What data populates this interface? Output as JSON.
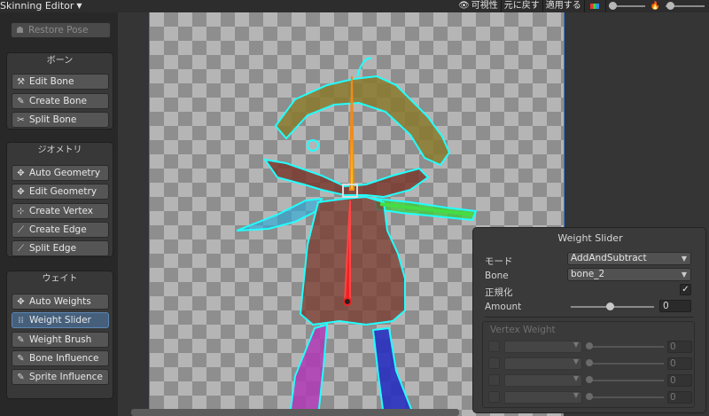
{
  "topbar": {
    "title": "Skinning Editor",
    "visibility_label": "可視性",
    "revert_label": "元に戻す",
    "apply_label": "適用する"
  },
  "restore_pose_label": "Restore Pose",
  "bone_group": {
    "title": "ボーン",
    "buttons": [
      "Edit Bone",
      "Create Bone",
      "Split Bone"
    ]
  },
  "geometry_group": {
    "title": "ジオメトリ",
    "buttons": [
      "Auto Geometry",
      "Edit Geometry",
      "Create Vertex",
      "Create Edge",
      "Split Edge"
    ]
  },
  "weight_group": {
    "title": "ウェイト",
    "buttons": [
      "Auto Weights",
      "Weight Slider",
      "Weight Brush",
      "Bone Influence",
      "Sprite Influence"
    ]
  },
  "weight_slider_panel": {
    "title": "Weight Slider",
    "mode_label": "モード",
    "mode_value": "AddAndSubtract",
    "bone_label": "Bone",
    "bone_value": "bone_2",
    "normalize_label": "正規化",
    "normalize_checked": true,
    "amount_label": "Amount",
    "amount_value": "0",
    "vertex_weight_title": "Vertex Weight",
    "vertex_rows": [
      {
        "value": "0"
      },
      {
        "value": "0"
      },
      {
        "value": "0"
      },
      {
        "value": "0"
      }
    ]
  }
}
